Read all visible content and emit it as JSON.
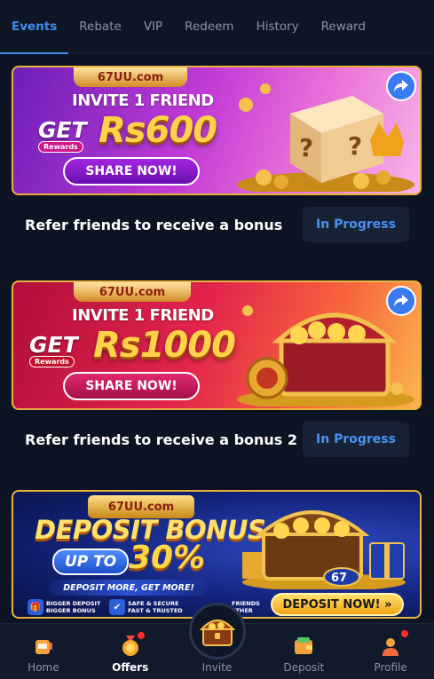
{
  "tabs": [
    {
      "label": "Events",
      "active": true
    },
    {
      "label": "Rebate"
    },
    {
      "label": "VIP"
    },
    {
      "label": "Redeem"
    },
    {
      "label": "History"
    },
    {
      "label": "Reward"
    }
  ],
  "events": [
    {
      "banner": {
        "brand": "67UU.com",
        "headline": "INVITE 1 FRIEND",
        "get_label": "GET",
        "rewards_tag": "Rewards",
        "amount": "Rs600",
        "cta": "SHARE NOW!"
      },
      "title": "Refer friends to receive a bonus",
      "status": "In Progress"
    },
    {
      "banner": {
        "brand": "67UU.com",
        "headline": "INVITE 1 FRIEND",
        "get_label": "GET",
        "rewards_tag": "Rewards",
        "amount": "Rs1000",
        "cta": "SHARE NOW!"
      },
      "title": "Refer friends to receive a bonus 2",
      "status": "In Progress"
    }
  ],
  "deposit_banner": {
    "brand": "67UU.com",
    "title": "DEPOSIT BONUS",
    "upto": "UP TO",
    "percent": "30%",
    "tagline": "DEPOSIT MORE, GET MORE!",
    "features": [
      {
        "line1": "BIGGER DEPOSIT",
        "line2": "BIGGER BONUS"
      },
      {
        "line1": "SAFE & SECURE",
        "line2": "FAST & TRUSTED"
      },
      {
        "line1": "FRIENDS",
        "line2": "ETHER"
      }
    ],
    "chest_badge": "67",
    "cta": "DEPOSIT NOW! »"
  },
  "bottom_nav": [
    {
      "label": "Home"
    },
    {
      "label": "Offers",
      "active": true
    },
    {
      "label": "Invite"
    },
    {
      "label": "Deposit"
    },
    {
      "label": "Profile"
    }
  ],
  "colors": {
    "background": "#0c1322",
    "accent": "#3f8ef0",
    "status_text": "#4a92f0",
    "gold": "#ffd24a",
    "notification": "#ff2a2a"
  }
}
